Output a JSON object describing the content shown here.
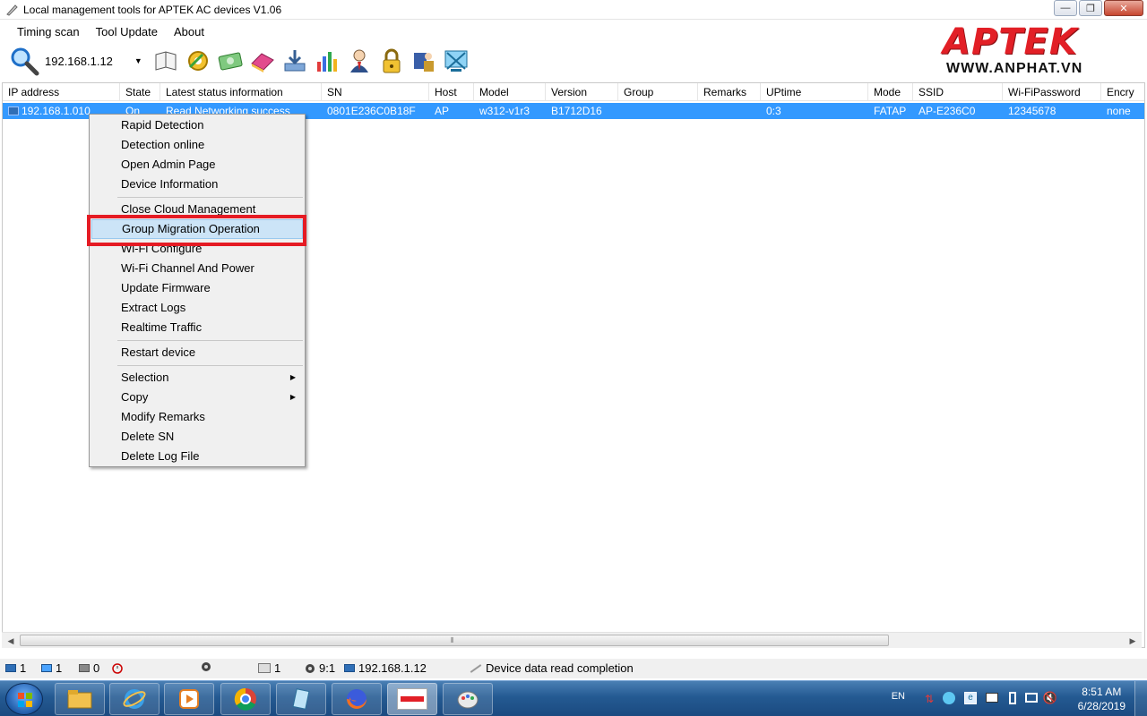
{
  "window": {
    "title": "Local management tools for APTEK AC devices  V1.06",
    "controls": {
      "minimize": "—",
      "maximize": "❐",
      "close": "✕"
    }
  },
  "menubar": [
    "Timing scan",
    "Tool Update",
    "About"
  ],
  "toolbar": {
    "ip_value": "192.168.1.12",
    "icons": [
      "search-icon",
      "book-icon",
      "gear-icon",
      "money-icon",
      "eraser-icon",
      "download-icon",
      "bar-chart-icon",
      "user-icon",
      "lock-icon",
      "people-icon",
      "network-icon"
    ]
  },
  "logo": {
    "brand": "APTEK",
    "url": "WWW.ANPHAT.VN"
  },
  "table": {
    "columns": [
      "IP address",
      "State",
      "Latest status information",
      "SN",
      "Host",
      "Model",
      "Version",
      "Group",
      "Remarks",
      "UPtime",
      "Mode",
      "SSID",
      "Wi-FiPassword",
      "Encry"
    ],
    "rows": [
      [
        "192.168.1.010",
        "On",
        "Read Networking success",
        "0801E236C0B18F",
        "AP",
        "w312-v1r3",
        "B1712D16",
        "",
        "",
        "0:3",
        "FATAP",
        "AP-E236C0",
        "12345678",
        "none"
      ]
    ]
  },
  "context_menu": {
    "items": [
      "Rapid Detection",
      "Detection online",
      "Open Admin Page",
      "Device Information",
      "Close Cloud Management",
      "Group Migration Operation",
      "Wi-Fi Configure",
      "Wi-Fi Channel And Power",
      "Update Firmware",
      "Extract Logs",
      "Realtime Traffic",
      "Restart device",
      "Selection",
      "Copy",
      "Modify Remarks",
      "Delete SN",
      "Delete Log File"
    ],
    "highlighted": "Group Migration Operation",
    "submenu_arrow": "▶"
  },
  "statusbar": {
    "total": "1",
    "online": "1",
    "offline": "0",
    "count": "1",
    "ratio": "9:1",
    "ip": "192.168.1.12",
    "message": "Device data read completion"
  },
  "taskbar": {
    "lang": "EN",
    "time": "8:51 AM",
    "date": "6/28/2019"
  },
  "colors": {
    "selection": "#3399ff",
    "highlight_box": "#e51b24",
    "brand": "#e21f26"
  }
}
